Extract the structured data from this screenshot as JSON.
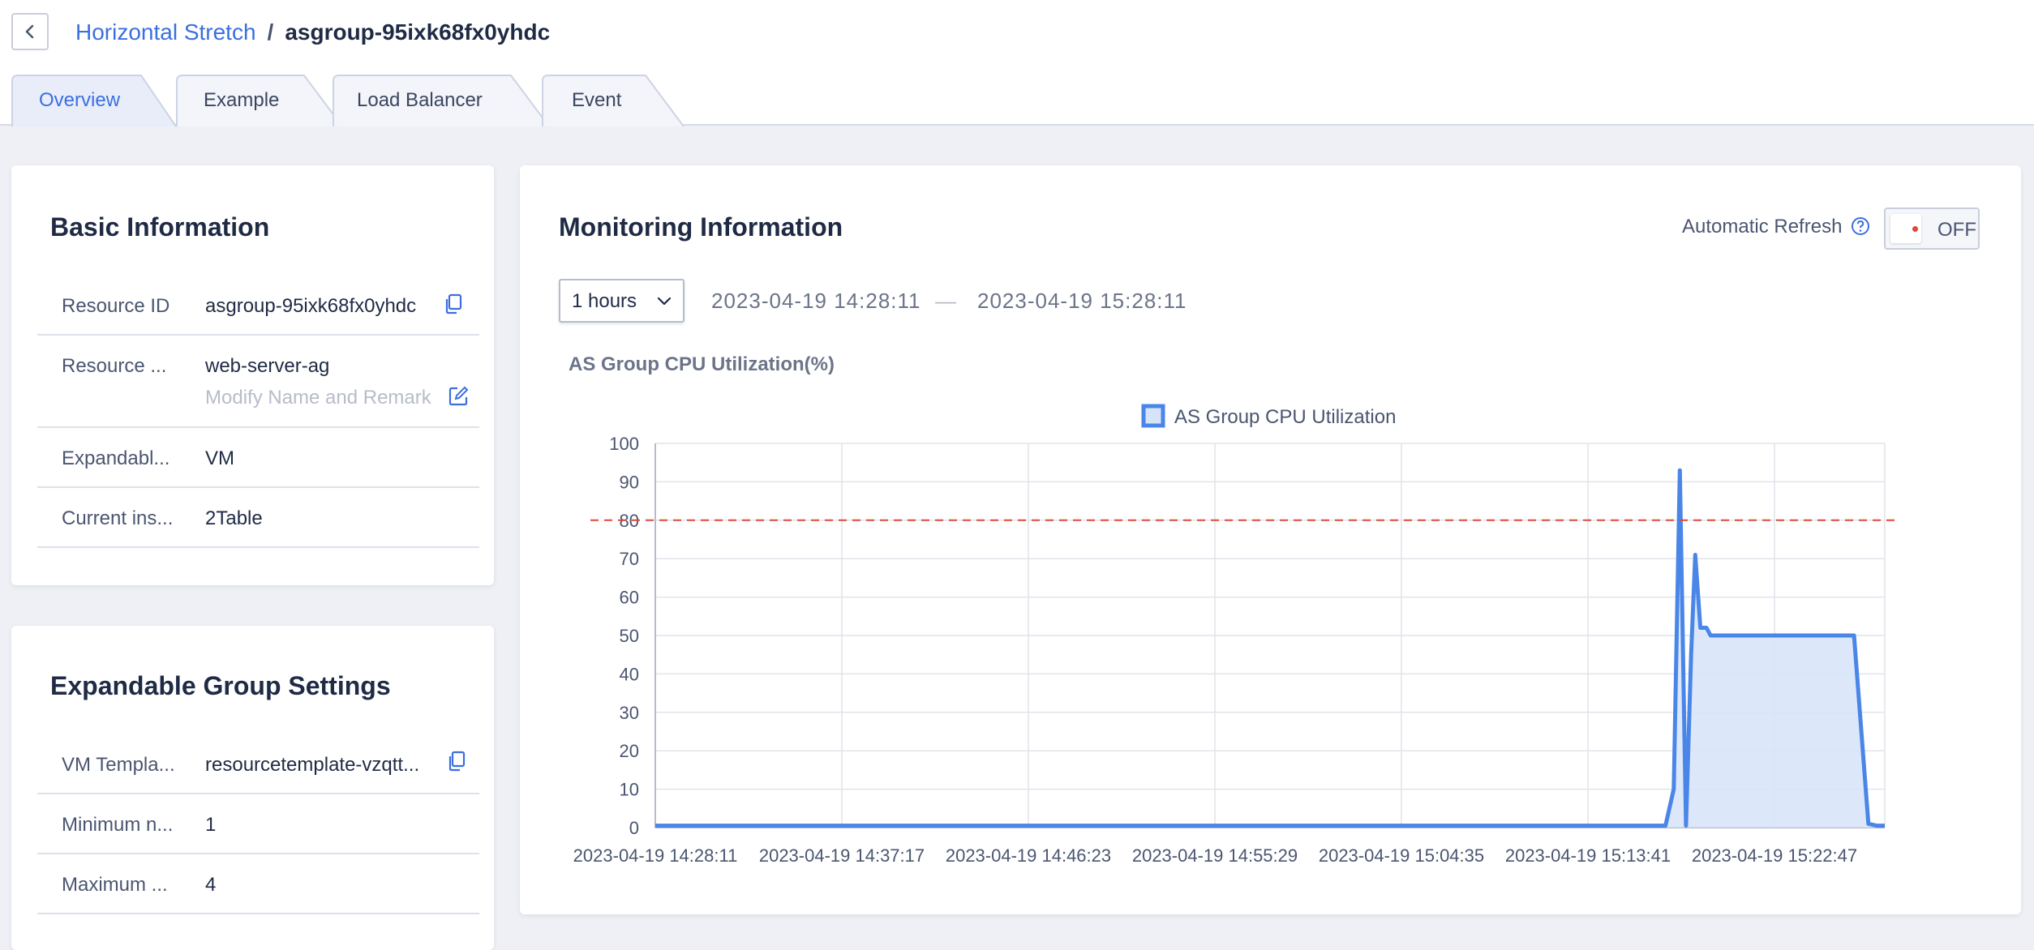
{
  "breadcrumb": {
    "parent": "Horizontal Stretch",
    "separator": "/",
    "current": "asgroup-95ixk68fx0yhdc"
  },
  "tabs": [
    {
      "label": "Overview",
      "active": true
    },
    {
      "label": "Example",
      "active": false
    },
    {
      "label": "Load Balancer",
      "active": false
    },
    {
      "label": "Event",
      "active": false
    }
  ],
  "basic_info": {
    "title": "Basic Information",
    "rows": [
      {
        "label": "Resource ID",
        "value": "asgroup-95ixk68fx0yhdc"
      },
      {
        "label": "Resource ...",
        "value": "web-server-ag",
        "sub": "Modify Name and Remark"
      },
      {
        "label": "Expandabl...",
        "value": "VM"
      },
      {
        "label": "Current ins...",
        "value": "2Table"
      }
    ]
  },
  "group_settings": {
    "title": "Expandable Group Settings",
    "rows": [
      {
        "label": "VM Templa...",
        "value": "resourcetemplate-vzqtt..."
      },
      {
        "label": "Minimum n...",
        "value": "1"
      },
      {
        "label": "Maximum ...",
        "value": "4"
      }
    ]
  },
  "monitoring": {
    "title": "Monitoring Information",
    "auto_refresh_label": "Automatic Refresh",
    "toggle_state": "OFF",
    "range_value": "1 hours",
    "range_start": "2023-04-19 14:28:11",
    "range_dash": "—",
    "range_end": "2023-04-19 15:28:11"
  },
  "chart_data": {
    "type": "area",
    "title": "AS Group CPU Utilization(%)",
    "legend": [
      "AS Group CPU Utilization"
    ],
    "legend_position": "top-center",
    "x_tick_labels": [
      "2023-04-19 14:28:11",
      "2023-04-19 14:37:17",
      "2023-04-19 14:46:23",
      "2023-04-19 14:55:29",
      "2023-04-19 15:04:35",
      "2023-04-19 15:13:41",
      "2023-04-19 15:22:47"
    ],
    "y_ticks": [
      0,
      10,
      20,
      30,
      40,
      50,
      60,
      70,
      80,
      90,
      100
    ],
    "ylim": [
      0,
      100
    ],
    "x_range_minutes": [
      0,
      60
    ],
    "threshold": 80,
    "grid": true,
    "series": [
      {
        "name": "AS Group CPU Utilization",
        "x": [
          0,
          5,
          10,
          15,
          20,
          25,
          30,
          35,
          40,
          45,
          49.3,
          49.7,
          50.0,
          50.3,
          50.55,
          50.75,
          51.0,
          51.3,
          51.5,
          52.0,
          55,
          57,
          58.5,
          59.2,
          59.6,
          60
        ],
        "y": [
          0.5,
          0.5,
          0.5,
          0.5,
          0.5,
          0.5,
          0.5,
          0.5,
          0.5,
          0.5,
          0.5,
          10,
          93,
          0.5,
          45,
          71,
          52,
          52,
          50,
          50,
          50,
          50,
          50,
          1,
          0.5,
          0.5
        ],
        "color": "#4a86e8"
      }
    ]
  },
  "colors": {
    "accent": "#3b6fe0",
    "series": "#4a86e8",
    "threshold": "#e0463a"
  }
}
